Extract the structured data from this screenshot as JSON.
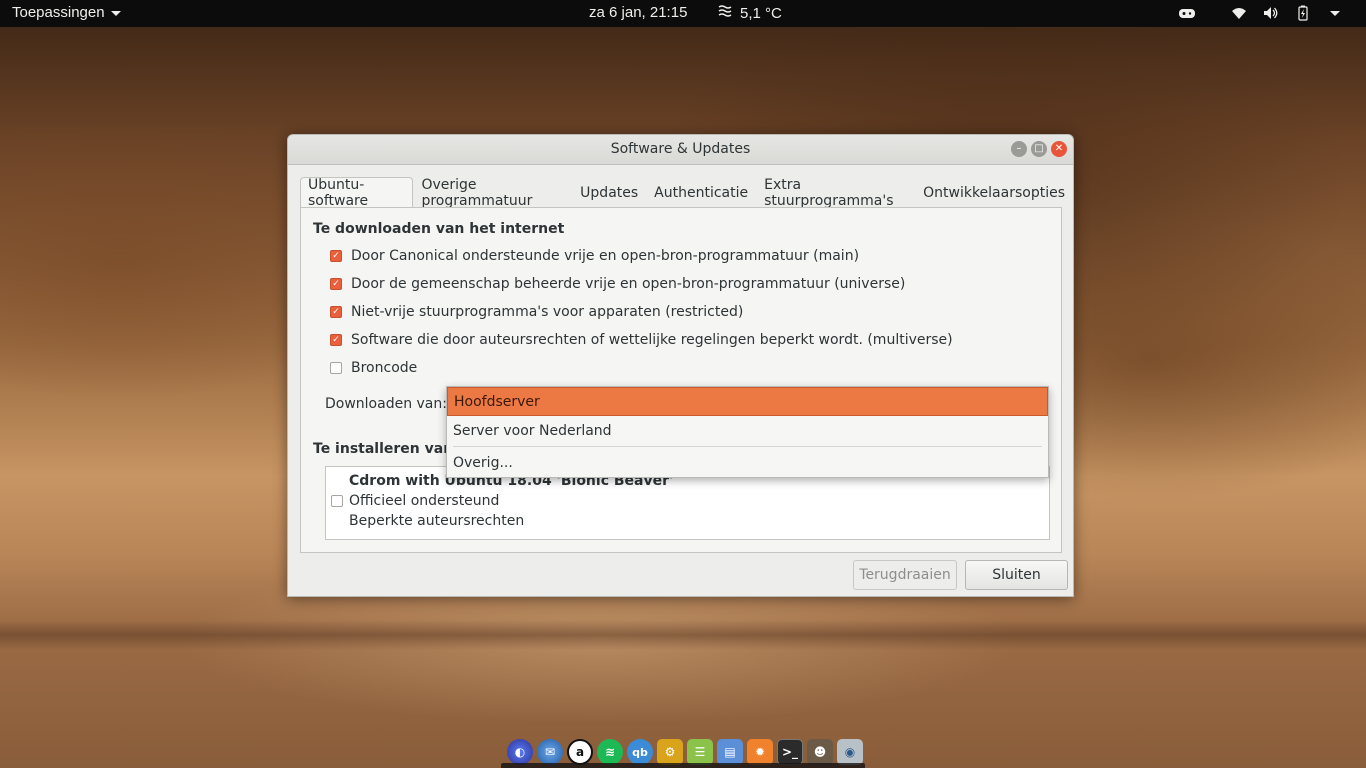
{
  "topbar": {
    "apps_label": "Toepassingen",
    "clock": "za  6 jan, 21:15",
    "weather": "5,1 °C",
    "weather_icon": "fog-icon",
    "tray_icons": [
      "gamepad-icon",
      "wifi-icon",
      "volume-icon",
      "battery-charging-icon",
      "power-icon"
    ]
  },
  "window": {
    "title": "Software & Updates",
    "tabs": [
      {
        "label": "Ubuntu-software",
        "active": true
      },
      {
        "label": "Overige programmatuur"
      },
      {
        "label": "Updates"
      },
      {
        "label": "Authenticatie"
      },
      {
        "label": "Extra stuurprogramma's"
      },
      {
        "label": "Ontwikkelaarsopties"
      }
    ],
    "download_section": {
      "title": "Te downloaden van het internet",
      "options": [
        {
          "label": "Door Canonical ondersteunde vrije en open-bron-programmatuur (main)",
          "checked": true
        },
        {
          "label": "Door de gemeenschap beheerde vrije en open-bron-programmatuur (universe)",
          "checked": true
        },
        {
          "label": "Niet-vrije stuurprogramma's voor apparaten (restricted)",
          "checked": true
        },
        {
          "label": "Software die door auteursrechten of wettelijke regelingen beperkt wordt. (multiverse)",
          "checked": true
        },
        {
          "label": "Broncode",
          "checked": false
        }
      ],
      "download_from_label": "Downloaden van:"
    },
    "install_section": {
      "title": "Te installeren vanaf",
      "cdrom": {
        "line1": "Cdrom with Ubuntu 18.04 'Bionic Beaver'",
        "line2": "Officieel ondersteund",
        "line3": "Beperkte auteursrechten",
        "checked": false
      }
    },
    "buttons": {
      "revert": "Terugdraaien",
      "close": "Sluiten"
    }
  },
  "dropdown": {
    "options": [
      "Hoofdserver",
      "Server voor Nederland",
      "Overig..."
    ],
    "selected": "Hoofdserver"
  },
  "dock": {
    "icons": [
      "firefox-icon",
      "thunderbird-icon",
      "amazon-icon",
      "spotify-icon",
      "qbittorrent-icon",
      "build-tool-icon",
      "rss-icon",
      "files-icon",
      "settings-gear-icon",
      "terminal-icon",
      "gimp-icon",
      "network-icon"
    ]
  },
  "colors": {
    "accent": "#e8603c",
    "selection": "#ec7843",
    "close_button": "#e8553b"
  }
}
